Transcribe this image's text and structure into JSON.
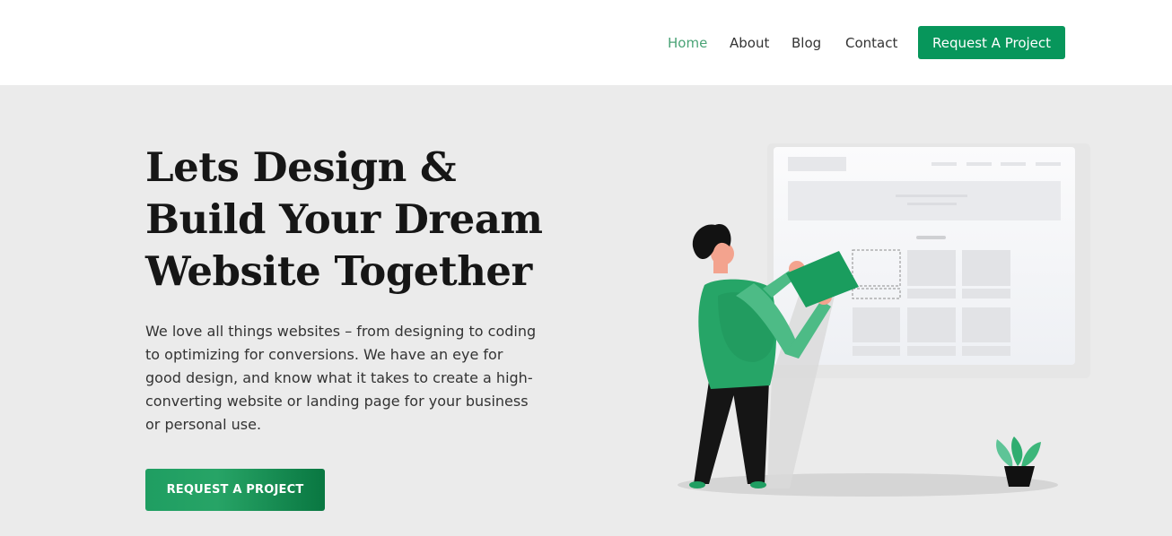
{
  "nav": {
    "items": [
      {
        "label": "Home",
        "active": true
      },
      {
        "label": "About",
        "active": false
      },
      {
        "label": "Blog",
        "active": false
      },
      {
        "label": "Contact",
        "active": false
      }
    ],
    "cta_label": "Request A Project"
  },
  "hero": {
    "title_lines": [
      "Lets Design &",
      "Build Your Dream",
      "Website Together"
    ],
    "description": "We love all things websites – from designing to coding to optimizing for conversions. We have an eye for good design, and know what it takes to create a high-converting website or landing page for your business or personal use.",
    "cta_label": "REQUEST A PROJECT"
  },
  "colors": {
    "brand_green": "#07965b",
    "nav_active": "#4aa376",
    "hero_bg": "#ebebeb",
    "header_bg": "#ffffff"
  }
}
